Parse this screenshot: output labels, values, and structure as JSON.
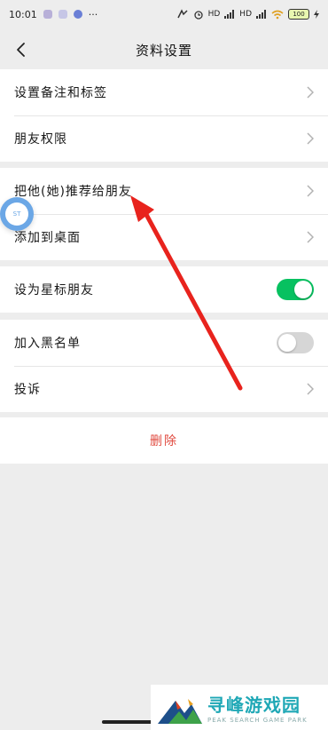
{
  "status_bar": {
    "time": "10:01",
    "more": "···",
    "hd1": "HD",
    "hd2": "HD",
    "battery": "100",
    "icons": [
      "app-icon-1",
      "app-icon-2",
      "shield-icon",
      "nfc-icon",
      "alarm-icon",
      "signal-icon",
      "signal-icon",
      "wifi-icon",
      "battery-icon",
      "charging-icon"
    ]
  },
  "nav": {
    "title": "资料设置",
    "back_icon": "back-chevron-icon"
  },
  "groups": [
    {
      "items": [
        {
          "label": "设置备注和标签",
          "control": "chevron"
        },
        {
          "label": "朋友权限",
          "control": "chevron"
        }
      ]
    },
    {
      "items": [
        {
          "label": "把他(她)推荐给朋友",
          "control": "chevron"
        },
        {
          "label": "添加到桌面",
          "control": "chevron"
        }
      ]
    },
    {
      "items": [
        {
          "label": "设为星标朋友",
          "control": "toggle",
          "checked": true
        }
      ]
    },
    {
      "items": [
        {
          "label": "加入黑名单",
          "control": "toggle",
          "checked": false
        },
        {
          "label": "投诉",
          "control": "chevron"
        }
      ]
    }
  ],
  "delete_label": "删除",
  "floating_bubble_text": "ST",
  "watermark": {
    "cn": "寻峰游戏园",
    "en": "PEAK SEARCH GAME PARK"
  },
  "colors": {
    "toggle_on": "#07c160",
    "delete_text": "#e04a3f",
    "annotation_arrow": "#e8231d"
  }
}
